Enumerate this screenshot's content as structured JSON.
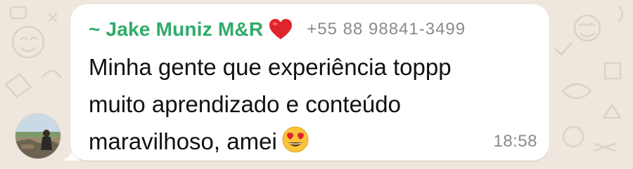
{
  "message": {
    "sender_name": "~ Jake Muniz M&R",
    "sender_badge_icon": "red-heart-icon",
    "sender_phone": "+55 88 98841-3499",
    "text_lines": [
      "Minha gente que experiência toppp",
      "muito aprendizado e conteúdo",
      "maravilhoso, amei"
    ],
    "trailing_emoji_icon": "heart-eyes-emoji-icon",
    "time": "18:58"
  },
  "colors": {
    "sender_name": "#2fab69",
    "bubble": "#ffffff",
    "chat_background": "#efe7dd",
    "meta_text": "#8a8a8a"
  }
}
